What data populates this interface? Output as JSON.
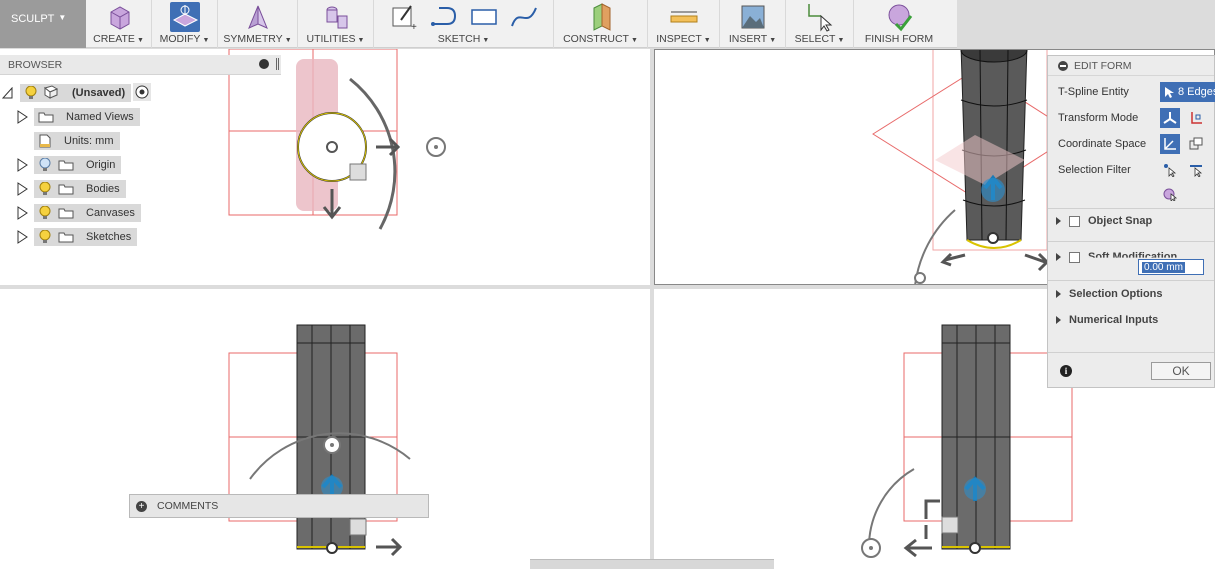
{
  "toolbar": {
    "workspace": "SCULPT",
    "groups": {
      "create": "CREATE",
      "modify": "MODIFY",
      "symmetry": "SYMMETRY",
      "utilities": "UTILITIES",
      "sketch": "SKETCH",
      "construct": "CONSTRUCT",
      "inspect": "INSPECT",
      "insert": "INSERT",
      "select": "SELECT",
      "finish_form": "FINISH FORM"
    }
  },
  "browser": {
    "title": "BROWSER",
    "root": "(Unsaved)",
    "items": [
      {
        "label": "Named Views"
      },
      {
        "label": "Units: mm"
      },
      {
        "label": "Origin"
      },
      {
        "label": "Bodies"
      },
      {
        "label": "Canvases"
      },
      {
        "label": "Sketches"
      }
    ]
  },
  "edit_form": {
    "title": "EDIT FORM",
    "rows": {
      "tspline_entity": "T-Spline Entity",
      "transform_mode": "Transform Mode",
      "coordinate_space": "Coordinate Space",
      "selection_filter": "Selection Filter"
    },
    "entity_value": "8 Edges",
    "object_snap": "Object Snap",
    "soft_modification": "Soft Modification",
    "soft_value": "0.00 mm",
    "selection_options": "Selection Options",
    "numerical_inputs": "Numerical Inputs",
    "ok": "OK"
  },
  "comments": {
    "label": "COMMENTS"
  },
  "colors": {
    "accent": "#3f6fb5",
    "workspace_bg": "#9b9b9b",
    "guide_red": "#e86a6a",
    "manip_blue": "#2a8fd0"
  }
}
